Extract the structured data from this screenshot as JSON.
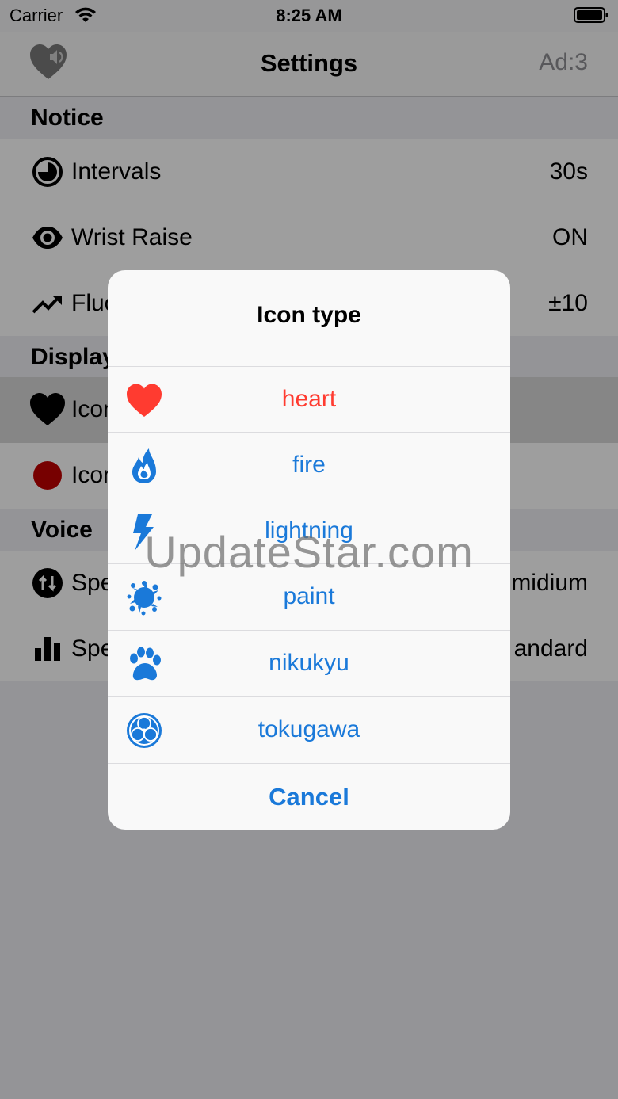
{
  "status_bar": {
    "carrier": "Carrier",
    "time": "8:25 AM"
  },
  "nav": {
    "title": "Settings",
    "ad_counter": "Ad:3"
  },
  "sections": {
    "notice": {
      "header": "Notice",
      "rows": [
        {
          "label": "Intervals",
          "value": "30s",
          "icon": "clock-icon"
        },
        {
          "label": "Wrist Raise",
          "value": "ON",
          "icon": "eye-icon"
        },
        {
          "label": "Fluc",
          "value": "±10",
          "icon": "trending-up-icon"
        }
      ]
    },
    "display": {
      "header": "Display",
      "rows": [
        {
          "label": "Icon",
          "value": "",
          "icon": "heart-icon"
        },
        {
          "label": "Icon",
          "value": "",
          "icon": "red-circle-icon",
          "color": "#c00000"
        }
      ]
    },
    "voice": {
      "header": "Voice",
      "rows": [
        {
          "label": "Spe",
          "value": "midium",
          "icon": "speed-arrows-icon"
        },
        {
          "label": "Spe",
          "value": "andard",
          "icon": "bar-chart-icon"
        }
      ]
    }
  },
  "dialog": {
    "title": "Icon type",
    "options": [
      {
        "label": "heart",
        "icon": "heart-icon",
        "color": "#ff3b30"
      },
      {
        "label": "fire",
        "icon": "fire-icon",
        "color": "#1a79d9"
      },
      {
        "label": "lightning",
        "icon": "lightning-icon",
        "color": "#1a79d9"
      },
      {
        "label": "paint",
        "icon": "paint-splash-icon",
        "color": "#1a79d9"
      },
      {
        "label": "nikukyu",
        "icon": "paw-icon",
        "color": "#1a79d9"
      },
      {
        "label": "tokugawa",
        "icon": "tokugawa-crest-icon",
        "color": "#1a79d9"
      }
    ],
    "cancel_label": "Cancel"
  },
  "watermark": "UpdateStar.com",
  "colors": {
    "accent": "#1a79d9",
    "danger": "#ff3b30"
  }
}
